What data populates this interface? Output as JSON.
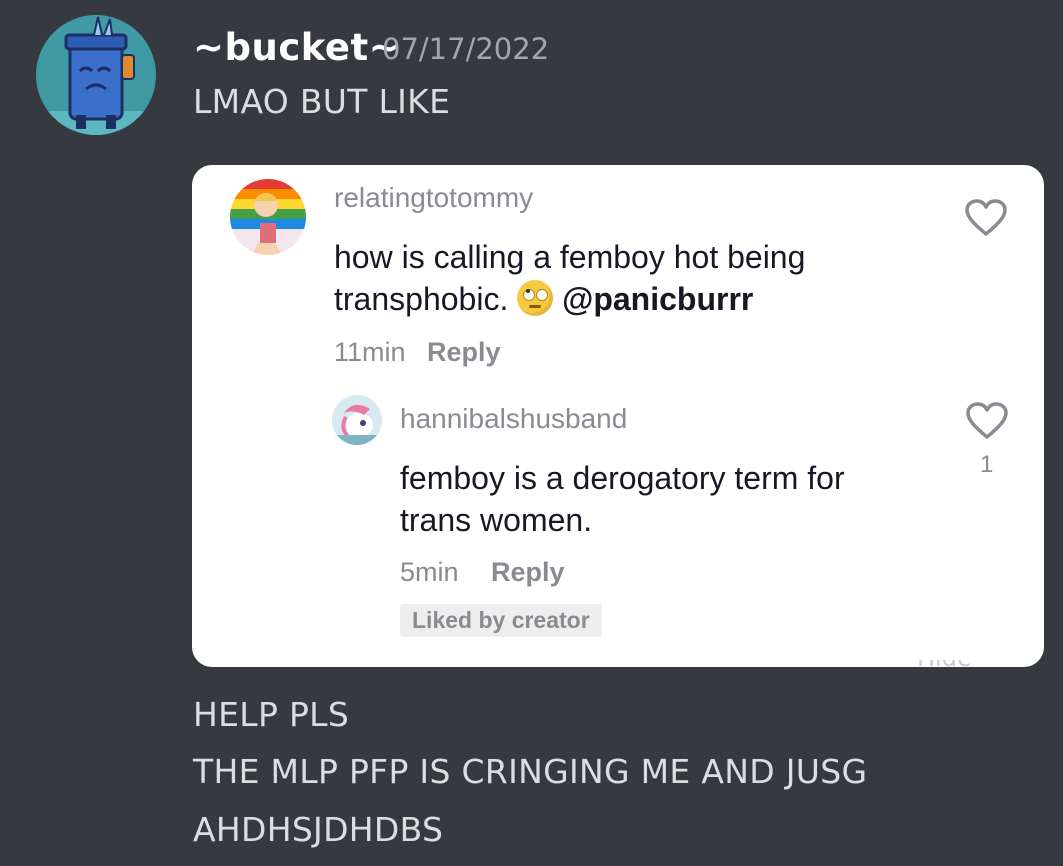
{
  "message": {
    "username": "~bucket~",
    "timestamp": "07/17/2022",
    "lines_before": [
      "LMAO BUT LIKE"
    ],
    "lines_after": [
      "HELP PLS",
      "THE MLP PFP IS CRINGING ME AND JUSG",
      "AHDHSJDHDBS"
    ]
  },
  "embed": {
    "comment": {
      "username": "relatingtotommy",
      "text_line1": "how is calling a femboy hot being",
      "text_line2": "transphobic.",
      "mention": "@panicburrr",
      "time": "11min",
      "reply_label": "Reply"
    },
    "reply": {
      "username": "hannibalshusband",
      "text_line1": "femboy is a derogatory term for",
      "text_line2": "trans women.",
      "time": "5min",
      "reply_label": "Reply",
      "likes": "1",
      "badge": "Liked by creator"
    },
    "hide_label": "Hide"
  },
  "icons": [
    "bucket-avatar-icon",
    "heart-icon",
    "eye-roll-emoji-icon"
  ]
}
